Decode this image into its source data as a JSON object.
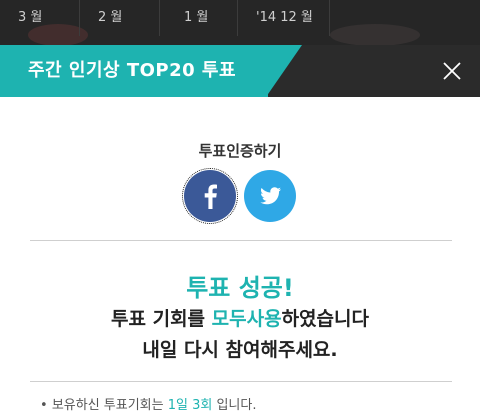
{
  "month_tabs": [
    {
      "label": "3 월"
    },
    {
      "label": "2 월"
    },
    {
      "label": "1 월"
    },
    {
      "label": "'14 12 월"
    }
  ],
  "header": {
    "title": "주간 인기상 TOP20 투표"
  },
  "auth": {
    "label": "투표인증하기",
    "facebook_icon": "facebook-icon",
    "twitter_icon": "twitter-icon"
  },
  "result": {
    "title": "투표 성공!",
    "line1_prefix": "투표 기회를 ",
    "line1_highlight": "모두사용",
    "line1_suffix": "하였습니다",
    "line2": "내일 다시 참여해주세요."
  },
  "note": {
    "prefix": "보유하신 투표기회는 ",
    "highlight": "1일 3회",
    "suffix": " 입니다."
  },
  "colors": {
    "accent": "#1eb3b0",
    "facebook": "#3b5998",
    "twitter": "#2fa8e6",
    "header_bg": "#2b2b2b"
  }
}
